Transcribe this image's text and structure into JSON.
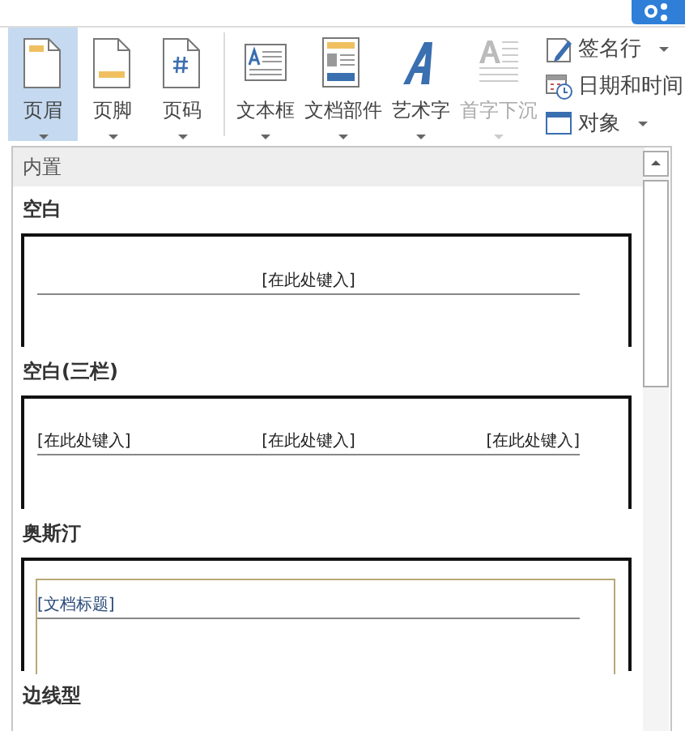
{
  "ribbon": {
    "groups": [
      {
        "buttons": [
          {
            "label": "页眉",
            "selected": true,
            "disabled": false
          },
          {
            "label": "页脚",
            "selected": false,
            "disabled": false
          },
          {
            "label": "页码",
            "selected": false,
            "disabled": false
          }
        ]
      },
      {
        "buttons": [
          {
            "label": "文本框",
            "selected": false,
            "disabled": false
          },
          {
            "label": "文档部件",
            "selected": false,
            "disabled": false
          },
          {
            "label": "艺术字",
            "selected": false,
            "disabled": false
          },
          {
            "label": "首字下沉",
            "selected": false,
            "disabled": true
          }
        ]
      }
    ],
    "small_buttons": [
      {
        "label": "签名行",
        "dropdown": true
      },
      {
        "label": "日期和时间",
        "dropdown": false
      },
      {
        "label": "对象",
        "dropdown": true
      }
    ]
  },
  "gallery": {
    "section": "内置",
    "items": [
      {
        "title": "空白",
        "kind": "single",
        "placeholders": [
          "[在此处键入]"
        ]
      },
      {
        "title": "空白(三栏)",
        "kind": "three",
        "placeholders": [
          "[在此处键入]",
          "[在此处键入]",
          "[在此处键入]"
        ]
      },
      {
        "title": "奥斯汀",
        "kind": "framed",
        "placeholders": [
          "[文档标题]"
        ]
      },
      {
        "title": "边线型"
      }
    ]
  }
}
